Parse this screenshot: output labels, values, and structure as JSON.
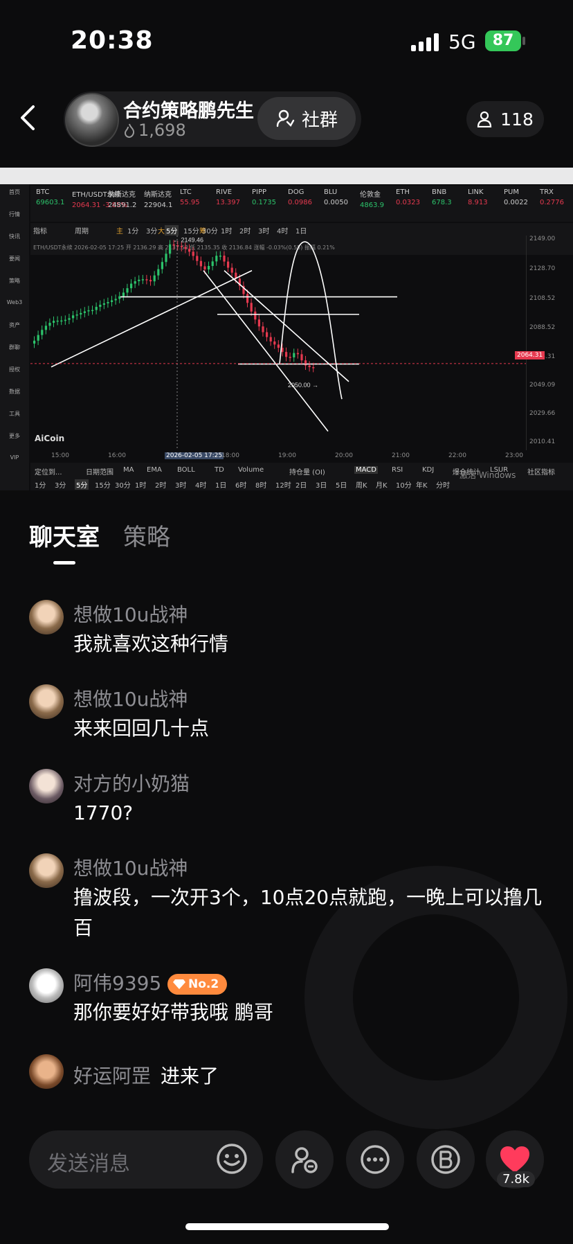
{
  "status_bar": {
    "time": "20:38",
    "network": "5G",
    "battery": "87"
  },
  "header": {
    "host_name": "合约策略鹏先生",
    "host_fans": "1,698",
    "community_label": "社群",
    "member_count": "118"
  },
  "stream": {
    "tickers": [
      {
        "name": "BTC",
        "price": "69603.1",
        "dir": "up"
      },
      {
        "name": "ETH/USDT永续",
        "price": "2064.31 -3.85%",
        "dir": "down"
      },
      {
        "name": "纳斯达克",
        "price": "24891.2",
        "dir": "flat"
      },
      {
        "name": "纳斯达克",
        "price": "22904.1",
        "dir": "flat"
      },
      {
        "name": "LTC",
        "price": "55.95",
        "dir": "down"
      },
      {
        "name": "RIVE",
        "price": "13.397",
        "dir": "down"
      },
      {
        "name": "PIPP",
        "price": "0.1735",
        "dir": "up"
      },
      {
        "name": "DOG",
        "price": "0.0986",
        "dir": "down"
      },
      {
        "name": "BLU",
        "price": "0.0050",
        "dir": "flat"
      },
      {
        "name": "伦敦金",
        "price": "4863.9",
        "dir": "up"
      },
      {
        "name": "ETH",
        "price": "0.0323",
        "dir": "down"
      },
      {
        "name": "BNB",
        "price": "678.3",
        "dir": "up"
      },
      {
        "name": "LINK",
        "price": "8.913",
        "dir": "down"
      },
      {
        "name": "PUM",
        "price": "0.0022",
        "dir": "flat"
      },
      {
        "name": "TRX",
        "price": "0.2776",
        "dir": "down"
      }
    ],
    "symbol_line": "ETH/USDT永续  2026-02-05 17:25  开 2136.29  高 2137.68  低 2135.35  收 2136.84  涨幅 -0.03%(0.55)  振幅 0.21%",
    "high_label": "2149.46",
    "low_label": "2050.00",
    "price_tag": "2064.31",
    "price_axis": [
      "2149.00",
      "2128.70",
      "2108.52",
      "2088.52",
      "2068.31",
      "2049.09",
      "2029.66",
      "2010.41"
    ],
    "time_axis": [
      "15:00",
      "16:00",
      "2026-02-05 17:25",
      "18:00",
      "19:00",
      "20:00",
      "21:00",
      "22:00",
      "23:00"
    ],
    "periods": [
      "1分",
      "3分",
      "5分",
      "15分",
      "30分",
      "1时",
      "2时",
      "3时",
      "4时",
      "1日"
    ],
    "indicators": [
      "定位到...",
      "日期范围",
      "MA",
      "EMA",
      "BOLL",
      "TD",
      "Volume",
      "持仓量 (OI)",
      "MACD",
      "RSI",
      "KDJ",
      "爆仓统计",
      "LSUR",
      "社区指标"
    ],
    "timeframes": [
      "1分",
      "3分",
      "5分",
      "15分",
      "30分",
      "1时",
      "2时",
      "3时",
      "4时",
      "1日",
      "6时",
      "8时",
      "12时",
      "2日",
      "3日",
      "5日",
      "周K",
      "月K",
      "10分",
      "年K",
      "分时"
    ],
    "left_nav": [
      "首页",
      "行情",
      "快讯",
      "要闻",
      "策略",
      "Web3",
      "资产",
      "群聊",
      "授权",
      "数据",
      "工具",
      "更多",
      "VIP"
    ],
    "brand": "AiCoin",
    "watermark": "激活 Windows",
    "chart_tool_labels": [
      "指标",
      "周期",
      "主",
      "大",
      "筹"
    ]
  },
  "tabs": {
    "chat": "聊天室",
    "strategy": "策略"
  },
  "messages": [
    {
      "user": "想做10u战神",
      "text": "我就喜欢这种行情"
    },
    {
      "user": "想做10u战神",
      "text": "来来回回几十点"
    },
    {
      "user": "对方的小奶猫",
      "text": "1770?"
    },
    {
      "user": "想做10u战神",
      "text": "撸波段，一次开3个，10点20点就跑，一晚上可以撸几百"
    },
    {
      "user": "阿伟9395",
      "badge": "No.2",
      "text": "那你要好好带我哦    鹏哥"
    },
    {
      "user": "好运阿罡",
      "text": "进来了"
    }
  ],
  "input": {
    "placeholder": "发送消息"
  },
  "likes": "7.8k",
  "colors": {
    "accent_green": "#34c759",
    "badge_orange": "#ff8a3d",
    "like_red": "#ff3b5c"
  }
}
